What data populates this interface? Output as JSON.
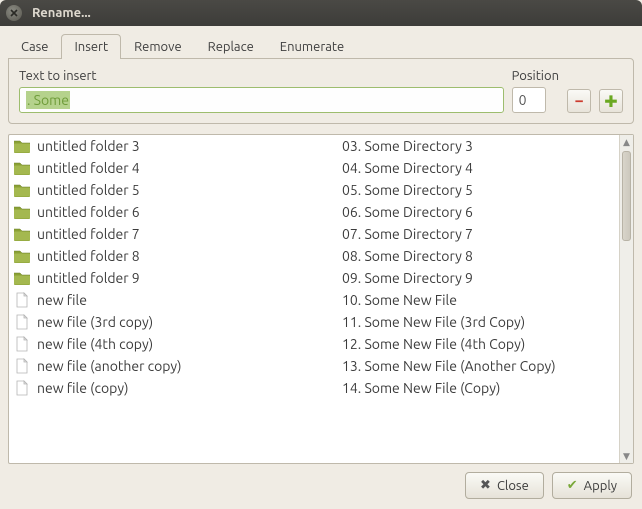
{
  "window": {
    "title": "Rename..."
  },
  "tabs": {
    "items": [
      {
        "label": "Case"
      },
      {
        "label": "Insert"
      },
      {
        "label": "Remove"
      },
      {
        "label": "Replace"
      },
      {
        "label": "Enumerate"
      }
    ],
    "active_index": 1
  },
  "insert_panel": {
    "text_label": "Text to insert",
    "text_value": ". Some",
    "position_label": "Position",
    "position_value": "0"
  },
  "file_list": [
    {
      "icon": "folder",
      "original": "untitled folder 3",
      "renamed": "03. Some Directory 3"
    },
    {
      "icon": "folder",
      "original": "untitled folder 4",
      "renamed": "04. Some Directory 4"
    },
    {
      "icon": "folder",
      "original": "untitled folder 5",
      "renamed": "05. Some Directory 5"
    },
    {
      "icon": "folder",
      "original": "untitled folder 6",
      "renamed": "06. Some Directory 6"
    },
    {
      "icon": "folder",
      "original": "untitled folder 7",
      "renamed": "07. Some Directory 7"
    },
    {
      "icon": "folder",
      "original": "untitled folder 8",
      "renamed": "08. Some Directory 8"
    },
    {
      "icon": "folder",
      "original": "untitled folder 9",
      "renamed": "09. Some Directory 9"
    },
    {
      "icon": "file",
      "original": "new file",
      "renamed": "10. Some New File"
    },
    {
      "icon": "file",
      "original": "new file (3rd copy)",
      "renamed": "11. Some New File (3rd Copy)"
    },
    {
      "icon": "file",
      "original": "new file (4th copy)",
      "renamed": "12. Some New File (4th Copy)"
    },
    {
      "icon": "file",
      "original": "new file (another copy)",
      "renamed": "13. Some New File (Another Copy)"
    },
    {
      "icon": "file",
      "original": "new file (copy)",
      "renamed": "14. Some New File (Copy)"
    }
  ],
  "buttons": {
    "close": "Close",
    "apply": "Apply"
  }
}
